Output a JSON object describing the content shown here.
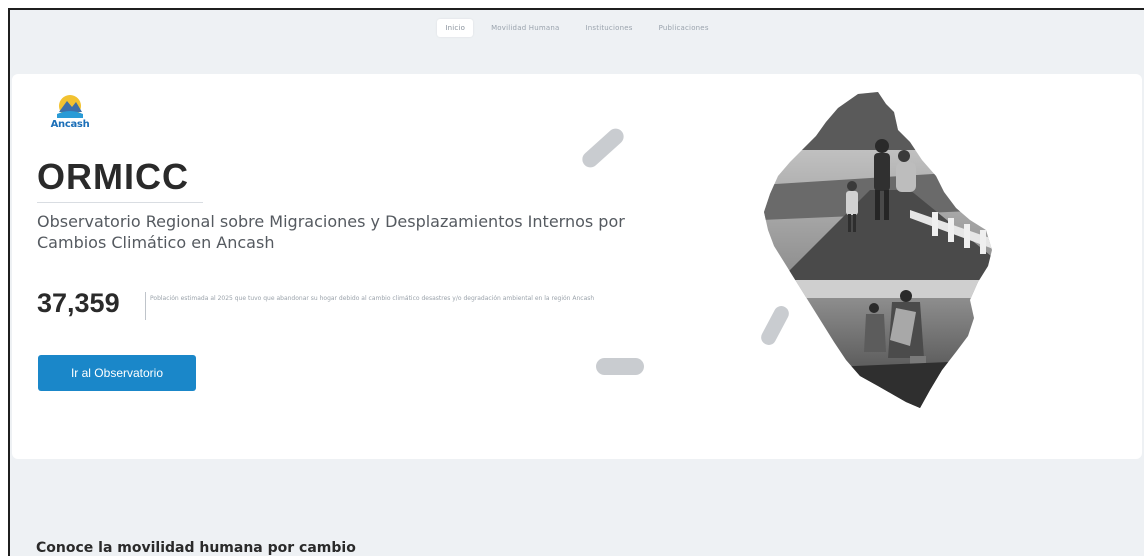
{
  "nav": {
    "items": [
      {
        "label": "Inicio",
        "active": true
      },
      {
        "label": "Movilidad Humana",
        "active": false
      },
      {
        "label": "Instituciones",
        "active": false
      },
      {
        "label": "Publicaciones",
        "active": false
      }
    ]
  },
  "hero": {
    "logo_text": "Ancash",
    "title": "ORMICC",
    "subtitle": "Observatorio Regional sobre Migraciones y Desplazamientos Internos por Cambios Climático en Ancash",
    "stat_value": "37,359",
    "stat_description": "Población estimada al 2025 que tuvo que abandonar su hogar debido al cambio climático desastres y/o degradación ambiental en la región Ancash",
    "cta_label": "Ir al Observatorio"
  },
  "section": {
    "heading": "Conoce la movilidad humana por cambio"
  },
  "colors": {
    "accent": "#1a87c9",
    "title": "#2a2a2a",
    "page_bg": "#eef1f4"
  }
}
